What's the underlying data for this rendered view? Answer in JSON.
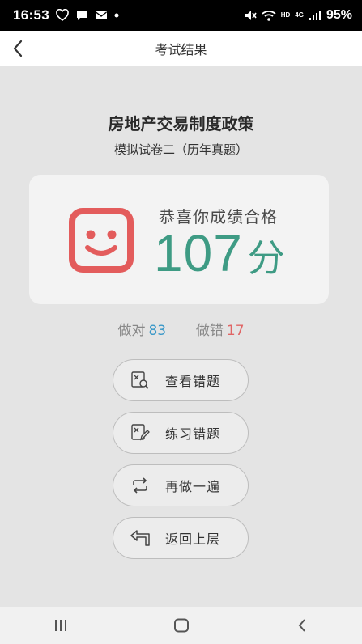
{
  "status_bar": {
    "time": "16:53",
    "battery": "95%",
    "network_hd": "HD",
    "network_4g": "4G"
  },
  "header": {
    "title": "考试结果"
  },
  "exam": {
    "title": "房地产交易制度政策",
    "subtitle": "模拟试卷二（历年真题）"
  },
  "result": {
    "congrats": "恭喜你成绩合格",
    "score": "107",
    "score_unit": "分"
  },
  "stats": {
    "correct_label": "做对",
    "correct_count": "83",
    "wrong_label": "做错",
    "wrong_count": "17"
  },
  "actions": {
    "view_wrong": "查看错题",
    "practice_wrong": "练习错题",
    "redo": "再做一遍",
    "go_back": "返回上层"
  },
  "colors": {
    "score": "#3e9b84",
    "smile": "#e35c5c",
    "correct": "#3a98c8",
    "wrong": "#e06565"
  }
}
